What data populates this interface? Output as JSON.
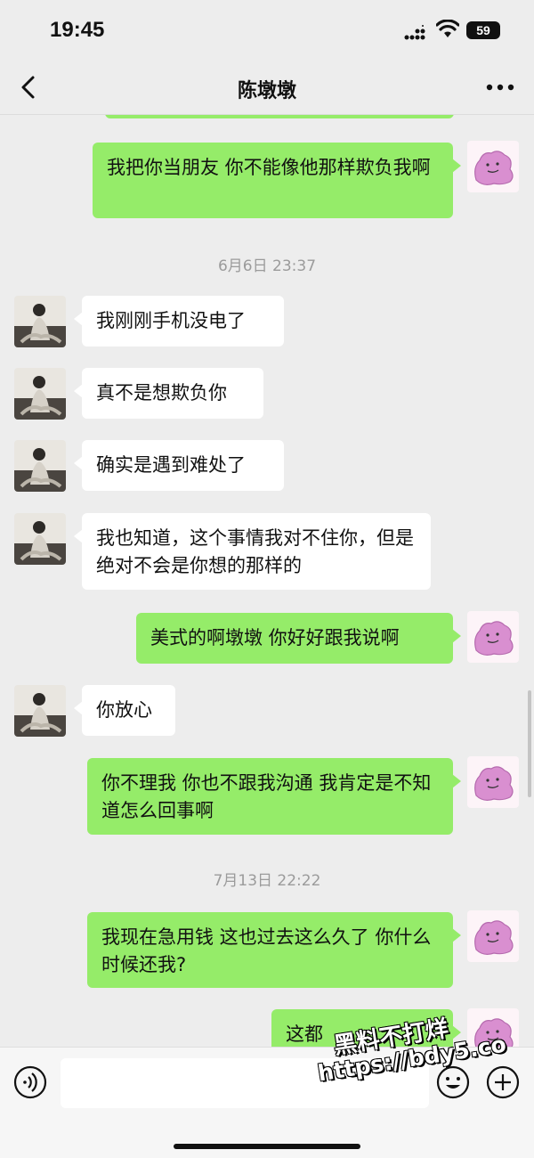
{
  "status_bar": {
    "time": "19:45",
    "battery": "59",
    "signal_icon": "signal-icon",
    "wifi_icon": "wifi-icon"
  },
  "nav": {
    "title": "陈墩墩",
    "back_icon": "chevron-left-icon",
    "more_icon": "more-dots-icon"
  },
  "messages": [
    {
      "sender": "me",
      "text": "我把你当朋友 你不能像他那样欺负我啊"
    },
    {
      "type": "timestamp",
      "text": "6月6日 23:37"
    },
    {
      "sender": "contact",
      "text": "我刚刚手机没电了"
    },
    {
      "sender": "contact",
      "text": "真不是想欺负你"
    },
    {
      "sender": "contact",
      "text": "确实是遇到难处了"
    },
    {
      "sender": "contact",
      "text": "我也知道，这个事情我对不住你，但是绝对不会是你想的那样的"
    },
    {
      "sender": "me",
      "text": "美式的啊墩墩 你好好跟我说啊"
    },
    {
      "sender": "contact",
      "text": "你放心"
    },
    {
      "sender": "me",
      "text": "你不理我 你也不跟我沟通 我肯定是不知道怎么回事啊"
    },
    {
      "type": "timestamp",
      "text": "7月13日 22:22"
    },
    {
      "sender": "me",
      "text": "我现在急用钱 这也过去这么久了 你什么时候还我?"
    },
    {
      "sender": "me",
      "text": "这都"
    }
  ],
  "watermark": {
    "line1": "黑料不打烊",
    "line2": "https://bdy5.co"
  },
  "input_bar": {
    "voice_icon": "voice-icon",
    "emoji_icon": "emoji-icon",
    "plus_icon": "plus-icon",
    "value": ""
  },
  "colors": {
    "outgoing_bubble": "#95ec69",
    "incoming_bubble": "#ffffff",
    "background": "#ededed"
  }
}
